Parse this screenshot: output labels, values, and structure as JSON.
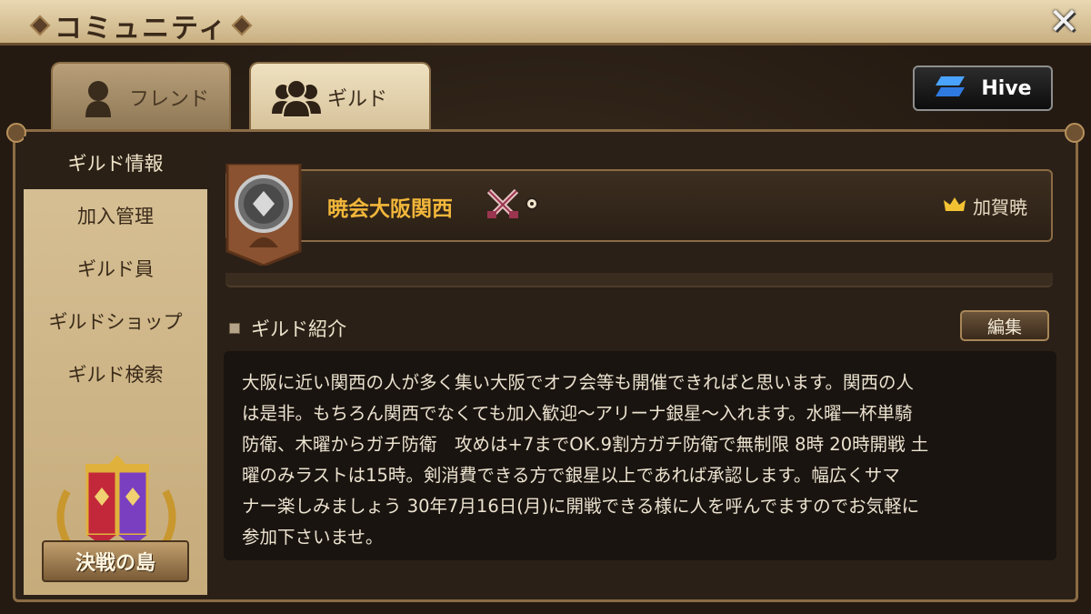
{
  "window": {
    "title": "コミュニティ",
    "close_symbol": "✕"
  },
  "tabs": [
    {
      "label": "フレンド",
      "icon": "single-person-icon",
      "active": false
    },
    {
      "label": "ギルド",
      "icon": "group-people-icon",
      "active": true
    }
  ],
  "hive_button": {
    "label": "Hive",
    "icon": "hive-logo-icon",
    "accent": "#3e8ff0"
  },
  "sidebar": {
    "items": [
      {
        "label": "ギルド情報",
        "active": true
      },
      {
        "label": "加入管理",
        "active": false
      },
      {
        "label": "ギルド員",
        "active": false
      },
      {
        "label": "ギルドショップ",
        "active": false
      },
      {
        "label": "ギルド検索",
        "active": false
      }
    ],
    "island_button": {
      "label": "決戦の島",
      "icon": "guild-banner-emblem-icon"
    }
  },
  "guild": {
    "name": "暁会大阪関西",
    "name_color": "#f2b73a",
    "badge_icon": "crossed-swords-icon",
    "leader_icon": "crown-icon",
    "leader_name": "加賀暁"
  },
  "intro": {
    "title": "ギルド紹介",
    "edit_label": "編集",
    "text": "大阪に近い関西の人が多く集い大阪でオフ会等も開催できればと思います。関西の人\nは是非。もちろん関西でなくても加入歓迎～アリーナ銀星～入れます。水曜一杯単騎\n防衛、木曜からガチ防衛　攻めは+7までOK.9割方ガチ防衛で無制限 8時 20時開戦 土\n曜のみラストは15時。剣消費できる方で銀星以上であれば承認します。幅広くサマ\nナー楽しみましょう 30年7月16日(月)に開戦できる様に人を呼んでますのでお気軽に\n参加下さいませ。"
  }
}
